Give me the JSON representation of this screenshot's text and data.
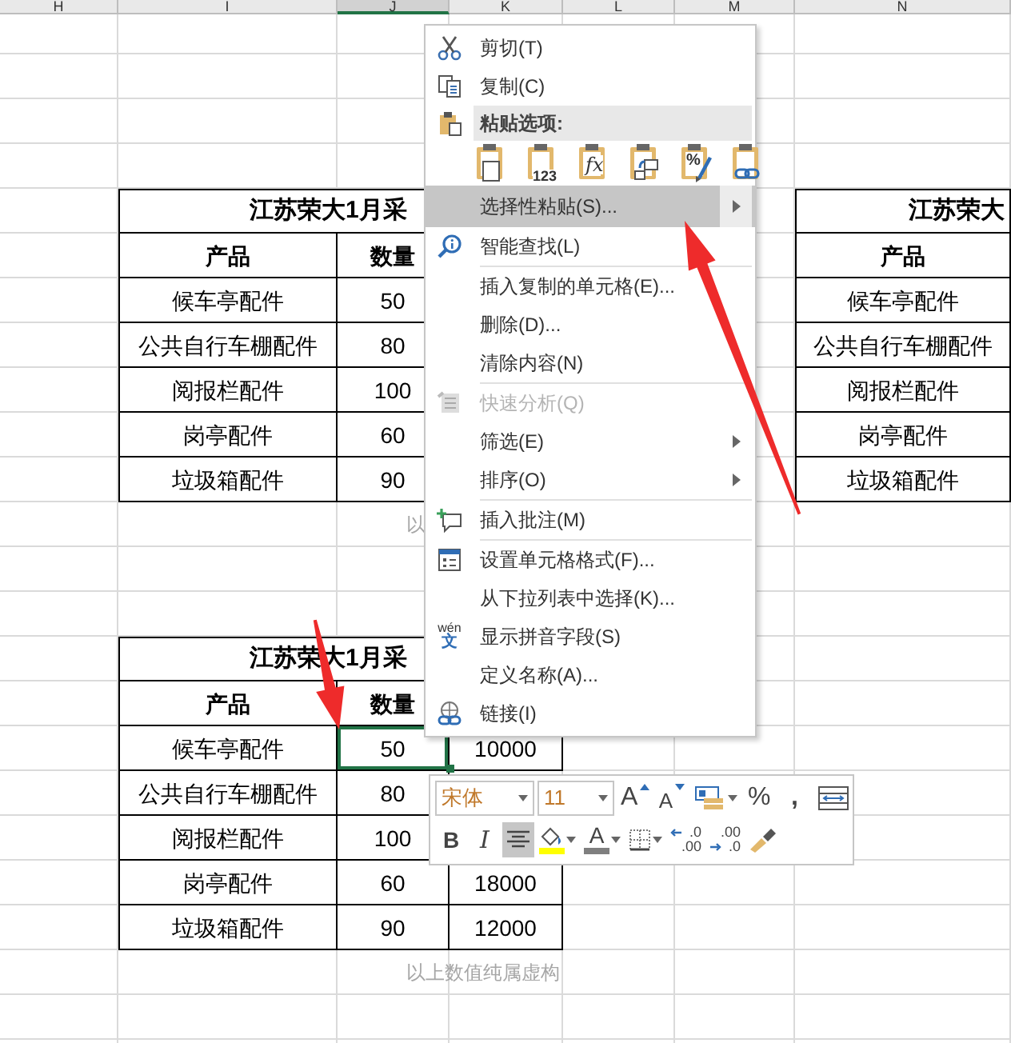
{
  "column_headers": [
    {
      "label": "H",
      "selected": false
    },
    {
      "label": "I",
      "selected": false
    },
    {
      "label": "J",
      "selected": true
    },
    {
      "label": "K",
      "selected": false
    },
    {
      "label": "L",
      "selected": false
    },
    {
      "label": "M",
      "selected": false
    },
    {
      "label": "N",
      "selected": false
    }
  ],
  "tables": [
    {
      "title": "江苏荣大1月采",
      "header_cells": [
        "产品",
        "数量"
      ],
      "rows": [
        {
          "cells": [
            {
              "text": "候车亭配件",
              "selected": false
            },
            {
              "text": "50",
              "selected": false
            }
          ]
        },
        {
          "cells": [
            {
              "text": "公共自行车棚配件",
              "selected": false
            },
            {
              "text": "80",
              "selected": false
            }
          ]
        },
        {
          "cells": [
            {
              "text": "阅报栏配件",
              "selected": false
            },
            {
              "text": "100",
              "selected": false
            }
          ]
        },
        {
          "cells": [
            {
              "text": "岗亭配件",
              "selected": false
            },
            {
              "text": "60",
              "selected": false
            }
          ]
        },
        {
          "cells": [
            {
              "text": "垃圾箱配件",
              "selected": false
            },
            {
              "text": "90",
              "selected": false
            }
          ]
        }
      ],
      "note": "以"
    },
    {
      "title": "江苏荣大1月采",
      "header_cells": [
        "产品",
        "数量"
      ],
      "rows": [
        {
          "cells": [
            {
              "text": "候车亭配件",
              "selected": false
            },
            {
              "text": "50",
              "selected": true
            },
            {
              "text": "10000",
              "selected": false
            }
          ]
        },
        {
          "cells": [
            {
              "text": "公共自行车棚配件",
              "selected": false
            },
            {
              "text": "80",
              "selected": false
            }
          ]
        },
        {
          "cells": [
            {
              "text": "阅报栏配件",
              "selected": false
            },
            {
              "text": "100",
              "selected": false
            }
          ]
        },
        {
          "cells": [
            {
              "text": "岗亭配件",
              "selected": false
            },
            {
              "text": "60",
              "selected": false
            },
            {
              "text": "18000",
              "selected": false
            }
          ]
        },
        {
          "cells": [
            {
              "text": "垃圾箱配件",
              "selected": false
            },
            {
              "text": "90",
              "selected": false
            },
            {
              "text": "12000",
              "selected": false
            }
          ]
        }
      ],
      "note": "以上数值纯属虚构"
    },
    {
      "title": "江苏荣大",
      "header_cells": [
        "产品"
      ],
      "rows": [
        {
          "cells": [
            {
              "text": "候车亭配件",
              "selected": false
            }
          ]
        },
        {
          "cells": [
            {
              "text": "公共自行车棚配件",
              "selected": false
            }
          ]
        },
        {
          "cells": [
            {
              "text": "阅报栏配件",
              "selected": false
            }
          ]
        },
        {
          "cells": [
            {
              "text": "岗亭配件",
              "selected": false
            }
          ]
        },
        {
          "cells": [
            {
              "text": "垃圾箱配件",
              "selected": false
            }
          ]
        }
      ]
    }
  ],
  "menu": {
    "items": [
      {
        "kind": "command",
        "label": "剪切(T)",
        "highlighted": false,
        "disabled": false,
        "submenu": false
      },
      {
        "kind": "command",
        "label": "复制(C)",
        "highlighted": false,
        "disabled": false,
        "submenu": false
      },
      {
        "kind": "header",
        "label": "粘贴选项:"
      },
      {
        "kind": "paste_options",
        "options": [
          {
            "kind": "paste"
          },
          {
            "kind": "values",
            "caption": "123"
          },
          {
            "kind": "formulas",
            "caption": "fx"
          },
          {
            "kind": "transpose"
          },
          {
            "kind": "formatting",
            "caption": "%"
          },
          {
            "kind": "link"
          }
        ]
      },
      {
        "kind": "command",
        "label": "选择性粘贴(S)...",
        "highlighted": true,
        "disabled": false,
        "submenu": true
      },
      {
        "kind": "command",
        "label": "智能查找(L)",
        "highlighted": false,
        "disabled": false,
        "submenu": false
      },
      {
        "kind": "separator"
      },
      {
        "kind": "command",
        "label": "插入复制的单元格(E)...",
        "highlighted": false,
        "disabled": false,
        "submenu": false
      },
      {
        "kind": "command",
        "label": "删除(D)...",
        "highlighted": false,
        "disabled": false,
        "submenu": false
      },
      {
        "kind": "command",
        "label": "清除内容(N)",
        "highlighted": false,
        "disabled": false,
        "submenu": false
      },
      {
        "kind": "separator"
      },
      {
        "kind": "command",
        "label": "快速分析(Q)",
        "highlighted": false,
        "disabled": true,
        "submenu": false
      },
      {
        "kind": "command",
        "label": "筛选(E)",
        "highlighted": false,
        "disabled": false,
        "submenu": true
      },
      {
        "kind": "command",
        "label": "排序(O)",
        "highlighted": false,
        "disabled": false,
        "submenu": true
      },
      {
        "kind": "separator"
      },
      {
        "kind": "command",
        "label": "插入批注(M)",
        "highlighted": false,
        "disabled": false,
        "submenu": false
      },
      {
        "kind": "separator"
      },
      {
        "kind": "command",
        "label": "设置单元格格式(F)...",
        "highlighted": false,
        "disabled": false,
        "submenu": false
      },
      {
        "kind": "command",
        "label": "从下拉列表中选择(K)...",
        "highlighted": false,
        "disabled": false,
        "submenu": false
      },
      {
        "kind": "command",
        "label": "显示拼音字段(S)",
        "icon_text": [
          "wén",
          "文"
        ],
        "highlighted": false,
        "disabled": false,
        "submenu": false
      },
      {
        "kind": "command",
        "label": "定义名称(A)...",
        "highlighted": false,
        "disabled": false,
        "submenu": false
      },
      {
        "kind": "command",
        "label": "链接(I)",
        "highlighted": false,
        "disabled": false,
        "submenu": false
      }
    ]
  },
  "mini_toolbar": {
    "font_field": {
      "value": "宋体"
    },
    "size_field": {
      "value": "11"
    },
    "rows": [
      [
        {
          "kind": "grow_font",
          "text": "A",
          "selected": false,
          "dropdown": false
        },
        {
          "kind": "shrink_font",
          "text": "A",
          "selected": false,
          "dropdown": false
        },
        {
          "kind": "cell_styles",
          "selected": false,
          "dropdown": true
        },
        {
          "kind": "percent",
          "text": "%",
          "selected": false,
          "dropdown": false
        },
        {
          "kind": "comma",
          "text": ",",
          "selected": false,
          "dropdown": false
        },
        {
          "kind": "merge",
          "selected": false,
          "dropdown": false
        }
      ],
      [
        {
          "kind": "bold",
          "text": "B",
          "selected": false,
          "dropdown": false
        },
        {
          "kind": "italic",
          "text": "I",
          "selected": false,
          "dropdown": false
        },
        {
          "kind": "align_center",
          "selected": true,
          "dropdown": false
        },
        {
          "kind": "fill_color",
          "color": "#ffff00",
          "selected": false,
          "dropdown": true
        },
        {
          "kind": "font_color",
          "text": "A",
          "color": "#7f7f7f",
          "selected": false,
          "dropdown": true
        },
        {
          "kind": "borders",
          "selected": false,
          "dropdown": true
        },
        {
          "kind": "increase_decimal",
          "text_lines": [
            ".0",
            ".00"
          ],
          "selected": false,
          "dropdown": false
        },
        {
          "kind": "decrease_decimal",
          "text_lines": [
            ".00",
            ".0"
          ],
          "selected": false,
          "dropdown": false
        },
        {
          "kind": "format_painter",
          "selected": false,
          "dropdown": false
        }
      ]
    ]
  },
  "annotation_arrows": [
    {
      "kind": "up_left"
    },
    {
      "kind": "down"
    }
  ]
}
